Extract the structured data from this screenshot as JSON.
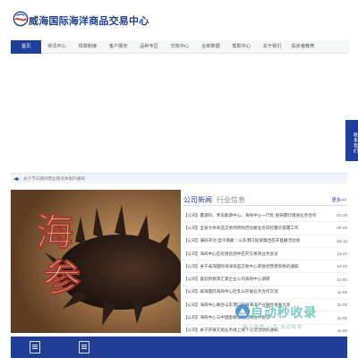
{
  "header": {
    "site_title": "威海国际海洋商品交易中心"
  },
  "nav": {
    "items": [
      "首页",
      "资讯中心",
      "规章制度",
      "客户服务",
      "品种专区",
      "交收中心",
      "合单数据",
      "帮助中心",
      "关于我们",
      "投资者教育"
    ],
    "active_index": 0
  },
  "notice": {
    "text": "关于节日期间营业网点休假的通知"
  },
  "side_tab": {
    "text": "联系我们"
  },
  "banner": {
    "text_1": "海",
    "text_2": "参"
  },
  "news": {
    "tab_active": "公司新闻",
    "tab_inactive": "行业信息",
    "more": "更多>>",
    "items": [
      {
        "title": "【公司】鑫浦科、青岛能源中心、海商中心一行赴·俗宋都行增进业务合作",
        "date": "01-26"
      },
      {
        "title": "【公司】全省大体商品交易场所防范化解业务风险警示部署工作",
        "date": "09-22"
      },
      {
        "title": "【公司】满好开创·自今南路｜山东港口投资集团召开直播活动会",
        "date": "04-12"
      },
      {
        "title": "【公司】海商中心在欢快氛围中召开交易商业务会议",
        "date": "12-21"
      },
      {
        "title": "【公司】关于威海国际海洋商品交易中心获批经营者资格的通知",
        "date": "12-22"
      },
      {
        "title": "【公司】喜迎新春游汇家企业公司海商中心调研",
        "date": "11-02"
      },
      {
        "title": "【公司】威海国际海商中心赴乳山开展业务合作交流",
        "date": "11-02"
      },
      {
        "title": "【公司】海商中心联合山东港口开展海洋产业融合发展大会",
        "date": "11-02"
      },
      {
        "title": "【公司】海商中心与中国金联签订战略合作协议",
        "date": "11-02"
      },
      {
        "title": "【公司】关于开展交易业务线上线下交流活动的通知",
        "date": "11-02"
      }
    ]
  },
  "watermark": {
    "title": "自动秒收录",
    "subtitle": "网上信誉·一次·自动收录"
  },
  "colors": {
    "primary": "#1f3f9b",
    "nav_bg": "#f6f7fa",
    "accent_red": "#d23b3b",
    "watermark_teal": "#6ec6c2"
  },
  "icons": {
    "logo": "globe-wave-logo",
    "notice": "speaker-icon",
    "service_1": "document-icon",
    "service_2": "edit-note-icon",
    "watermark": "arrow-logo"
  }
}
